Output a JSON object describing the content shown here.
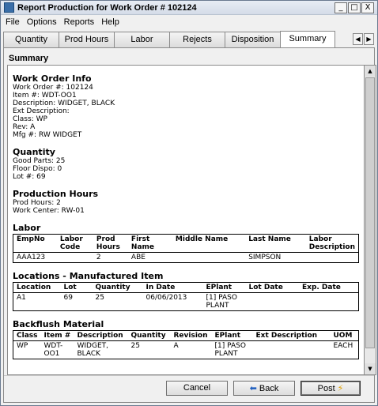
{
  "window": {
    "title": "Report Production for Work Order # 102124",
    "minimize": "_",
    "maximize": "□",
    "close": "X"
  },
  "menu": [
    "File",
    "Options",
    "Reports",
    "Help"
  ],
  "tabs": [
    "Quantity",
    "Prod Hours",
    "Labor",
    "Rejects",
    "Disposition",
    "Summary"
  ],
  "active_tab": "Summary",
  "tab_scroll": {
    "left": "◀",
    "right": "▶"
  },
  "panel_title": "Summary",
  "work_order_info": {
    "heading": "Work Order Info",
    "lines": [
      "Work Order #: 102124",
      "Item #: WDT-OO1",
      "Description: WIDGET, BLACK",
      "Ext Description:",
      "Class: WP",
      "Rev: A",
      "Mfg #: RW WIDGET"
    ]
  },
  "quantity": {
    "heading": "Quantity",
    "lines": [
      "Good Parts: 25",
      "Floor Dispo: 0",
      "Lot #: 69"
    ]
  },
  "production_hours": {
    "heading": "Production Hours",
    "lines": [
      "Prod Hours: 2",
      "Work Center: RW-01"
    ]
  },
  "labor": {
    "heading": "Labor",
    "columns": [
      "EmpNo",
      "Labor Code",
      "Prod Hours",
      "First Name",
      "Middle Name",
      "Last Name",
      "Labor Description"
    ],
    "rows": [
      [
        "AAA123",
        "",
        "2",
        "ABE",
        "",
        "SIMPSON",
        ""
      ]
    ]
  },
  "locations": {
    "heading": "Locations - Manufactured Item",
    "columns": [
      "Location",
      "Lot",
      "Quantity",
      "In Date",
      "EPlant",
      "Lot Date",
      "Exp. Date"
    ],
    "rows": [
      [
        "A1",
        "69",
        "25",
        "06/06/2013",
        "[1] PASO PLANT",
        "",
        ""
      ]
    ]
  },
  "backflush": {
    "heading": "Backflush Material",
    "columns": [
      "Class",
      "Item #",
      "Description",
      "Quantity",
      "Revision",
      "EPlant",
      "Ext Description",
      "UOM"
    ],
    "rows": [
      [
        "WP",
        "WDT-OO1",
        "WIDGET, BLACK",
        "25",
        "A",
        "[1] PASO PLANT",
        "",
        "EACH"
      ]
    ]
  },
  "buttons": {
    "cancel": "Cancel",
    "back": "Back",
    "post": "Post"
  },
  "icons": {
    "back": "back-arrow-icon",
    "post": "lightning-bolt-icon"
  }
}
